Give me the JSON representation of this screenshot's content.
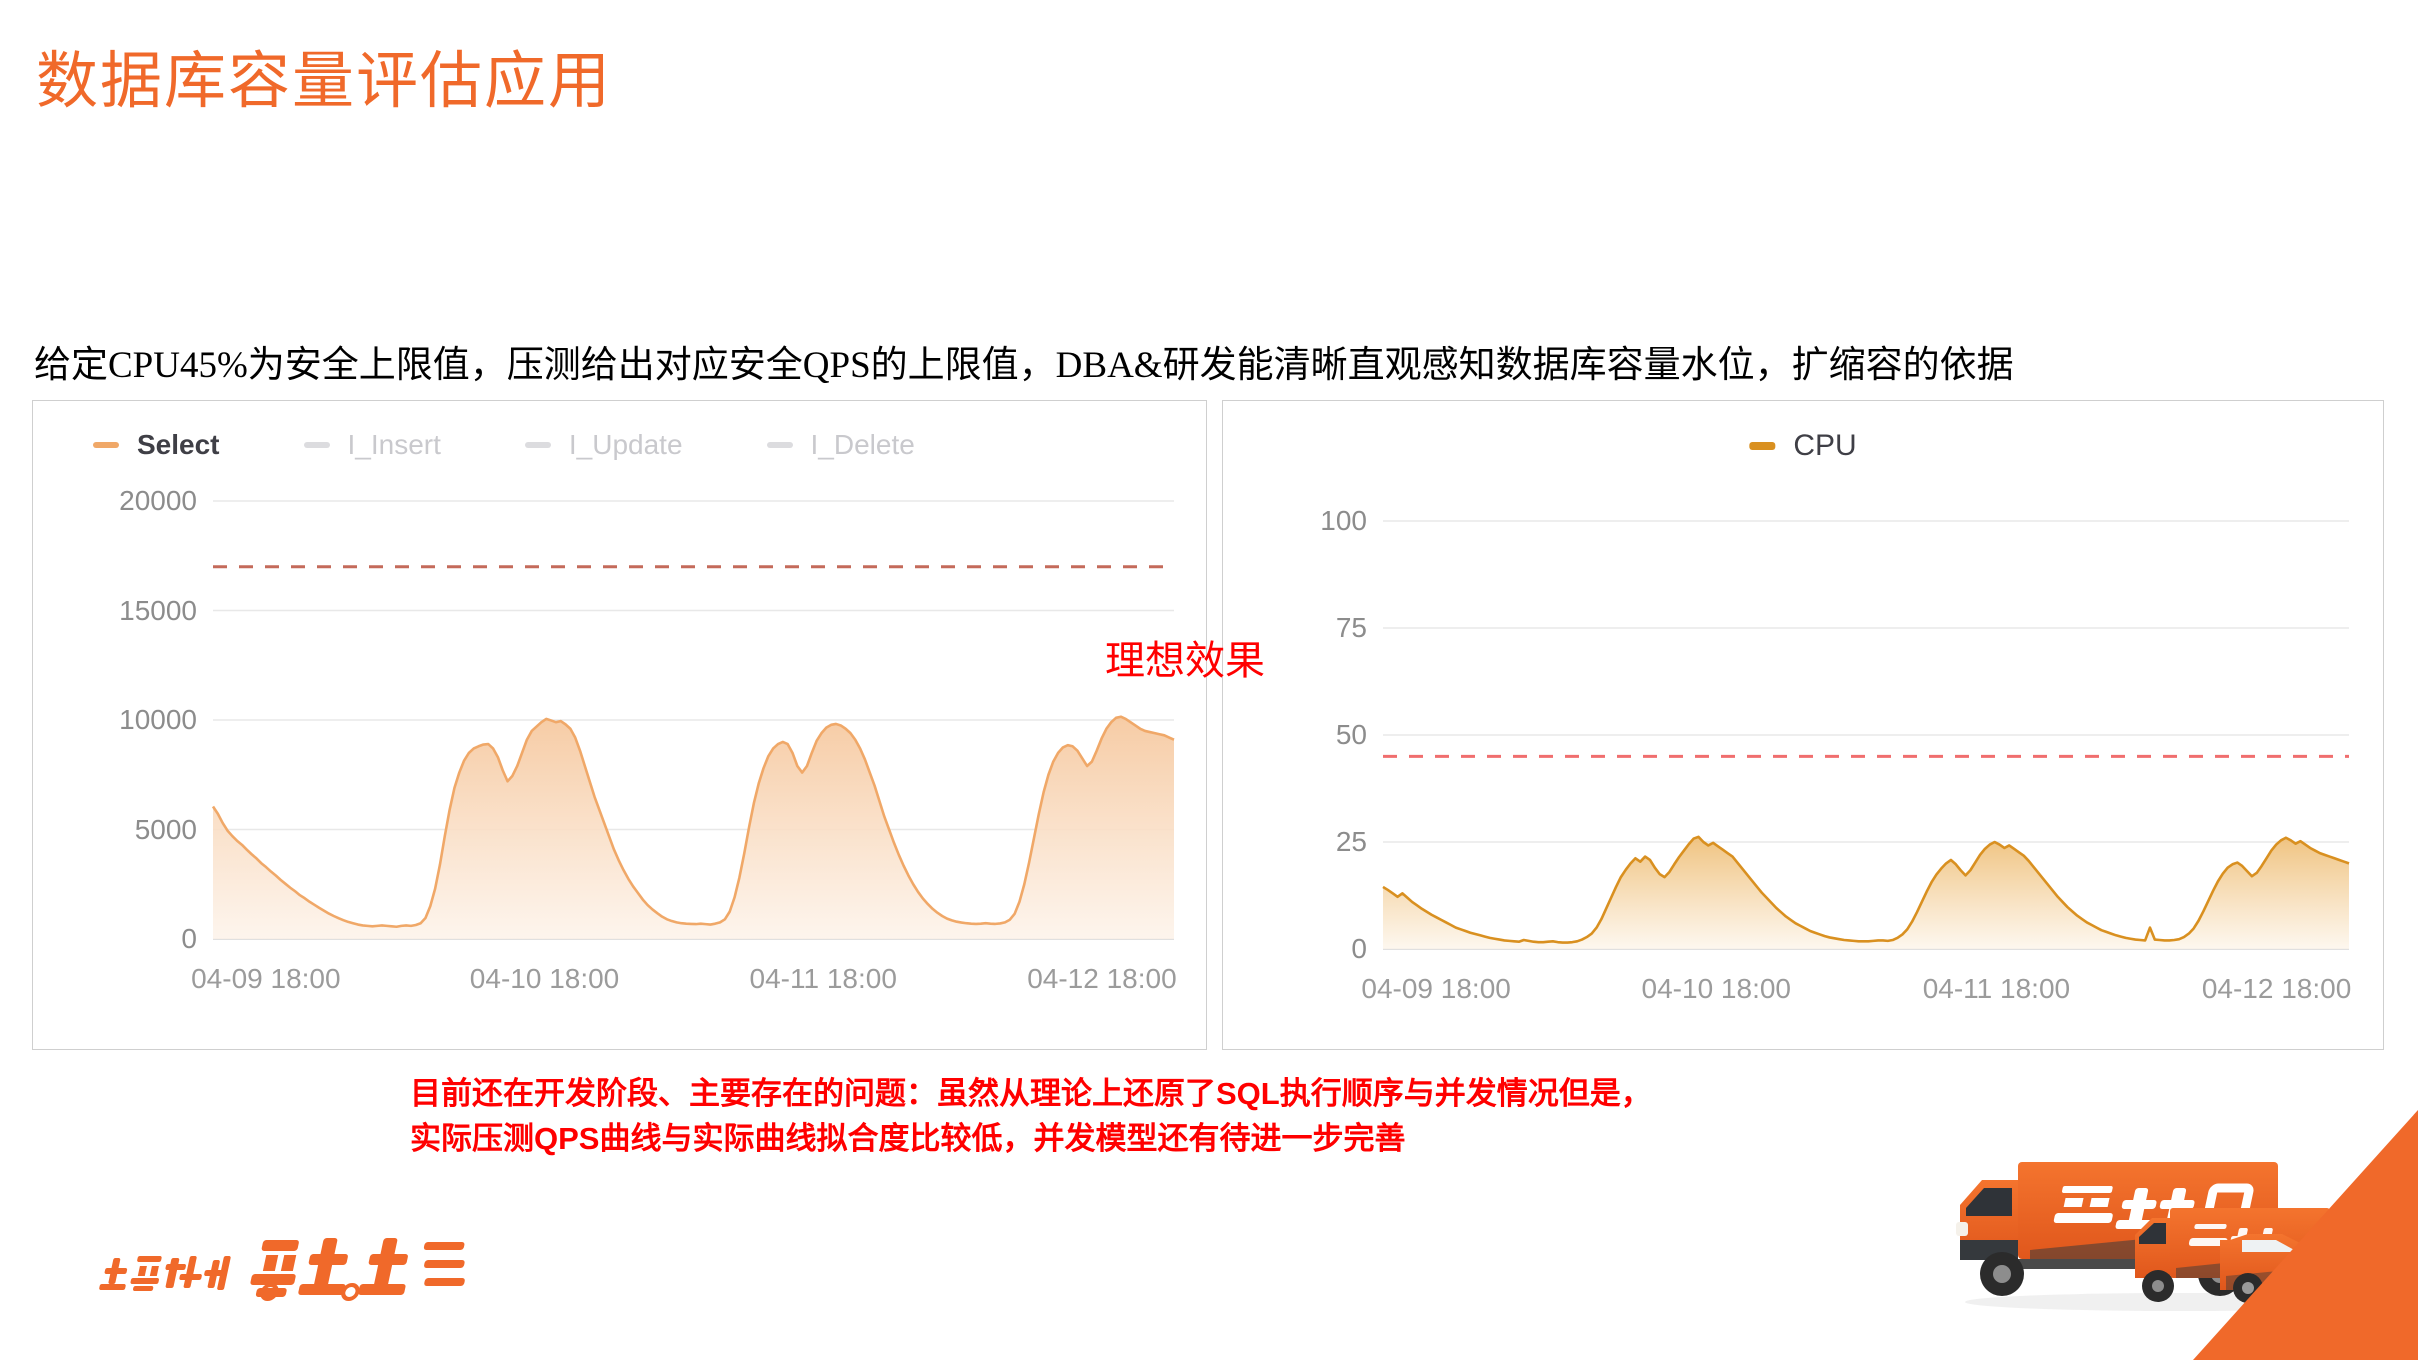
{
  "title": "数据库容量评估应用",
  "subtitle": "给定CPU45%为安全上限值，压测给出对应安全QPS的上限值，DBA&研发能清晰直观感知数据库容量水位，扩缩容的依据",
  "annotations": {
    "ideal_effect": "理想效果",
    "note_line1": "目前还在开发阶段、主要存在的问题：虽然从理论上还原了SQL执行顺序与并发情况但是，",
    "note_line2": "实际压测QPS曲线与实际曲线拟合度比较低，并发模型还有待进一步完善"
  },
  "brand": {
    "logo_text": "拉货就找货拉拉",
    "accent_orange": "#F0692A",
    "wedge_color": "#F0692A"
  },
  "chart_data": [
    {
      "type": "area",
      "title": "",
      "panel": "left",
      "legend": [
        {
          "label": "Select",
          "color": "#F0A868",
          "active": true
        },
        {
          "label": "I_Insert",
          "color": "#dcdcdf",
          "active": false
        },
        {
          "label": "I_Update",
          "color": "#dcdcdf",
          "active": false
        },
        {
          "label": "I_Delete",
          "color": "#dcdcdf",
          "active": false
        }
      ],
      "legend_position": "top-left",
      "xlabel": "",
      "ylabel": "",
      "ylim": [
        0,
        20000
      ],
      "yticks": [
        0,
        5000,
        10000,
        15000,
        20000
      ],
      "ytick_labels": [
        "0",
        "5000",
        "10000",
        "15000",
        "20000"
      ],
      "xtick_labels": [
        "04-09 18:00",
        "04-10 18:00",
        "04-11 18:00",
        "04-12 18:00"
      ],
      "xtick_positions": [
        0.055,
        0.345,
        0.635,
        0.925
      ],
      "grid": true,
      "threshold": {
        "value": 17000,
        "color": "#c46a5a",
        "style": "dashed",
        "label": ""
      },
      "series": [
        {
          "name": "Select",
          "color": "#F0A868",
          "fill_gradient": [
            "#F6C9A0",
            "#FDF3EA"
          ],
          "values": [
            6050,
            5720,
            5300,
            4950,
            4700,
            4480,
            4300,
            4080,
            3870,
            3680,
            3460,
            3280,
            3080,
            2900,
            2700,
            2520,
            2340,
            2180,
            2000,
            1860,
            1700,
            1560,
            1420,
            1290,
            1160,
            1050,
            950,
            860,
            780,
            720,
            660,
            620,
            600,
            580,
            600,
            620,
            600,
            580,
            560,
            600,
            620,
            600,
            640,
            720,
            960,
            1500,
            2300,
            3400,
            4700,
            5900,
            6900,
            7600,
            8150,
            8500,
            8700,
            8800,
            8880,
            8900,
            8700,
            8300,
            7700,
            7200,
            7450,
            7900,
            8500,
            9100,
            9500,
            9700,
            9900,
            10050,
            9980,
            9900,
            9950,
            9800,
            9600,
            9200,
            8600,
            7900,
            7200,
            6500,
            5900,
            5300,
            4700,
            4100,
            3600,
            3150,
            2750,
            2400,
            2100,
            1800,
            1550,
            1350,
            1180,
            1020,
            900,
            820,
            760,
            720,
            700,
            690,
            680,
            700,
            680,
            660,
            700,
            760,
            900,
            1250,
            1900,
            2800,
            3900,
            5100,
            6200,
            7100,
            7800,
            8350,
            8700,
            8900,
            9000,
            8900,
            8500,
            7900,
            7600,
            7900,
            8500,
            9050,
            9400,
            9650,
            9780,
            9820,
            9750,
            9600,
            9400,
            9100,
            8700,
            8200,
            7600,
            7000,
            6300,
            5600,
            5000,
            4400,
            3850,
            3350,
            2900,
            2500,
            2150,
            1850,
            1600,
            1380,
            1200,
            1050,
            930,
            850,
            790,
            750,
            720,
            700,
            690,
            700,
            720,
            700,
            690,
            710,
            760,
            880,
            1150,
            1700,
            2500,
            3500,
            4600,
            5700,
            6700,
            7500,
            8100,
            8500,
            8750,
            8850,
            8800,
            8600,
            8250,
            7900,
            8100,
            8600,
            9150,
            9600,
            9900,
            10100,
            10150,
            10050,
            9900,
            9750,
            9600,
            9500,
            9450,
            9400,
            9350,
            9300,
            9200,
            9100
          ]
        }
      ]
    },
    {
      "type": "area",
      "title": "",
      "panel": "right",
      "legend": [
        {
          "label": "CPU",
          "color": "#D99020",
          "active": true
        }
      ],
      "legend_position": "top-center",
      "xlabel": "",
      "ylabel": "",
      "ylim": [
        0,
        100
      ],
      "yticks": [
        0,
        25,
        50,
        75,
        100
      ],
      "ytick_labels": [
        "0",
        "25",
        "50",
        "75",
        "100"
      ],
      "xtick_labels": [
        "04-09 18:00",
        "04-10 18:00",
        "04-11 18:00",
        "04-12 18:00"
      ],
      "xtick_positions": [
        0.055,
        0.345,
        0.635,
        0.925
      ],
      "grid": true,
      "threshold": {
        "value": 45,
        "color": "#F06E6E",
        "style": "dashed",
        "label": ""
      },
      "series": [
        {
          "name": "CPU",
          "color": "#D99020",
          "fill_gradient": [
            "#EFC07A",
            "#FDF6EC"
          ],
          "values": [
            14.5,
            13.8,
            13.0,
            12.2,
            13.0,
            12.0,
            11.0,
            10.2,
            9.4,
            8.7,
            8.0,
            7.4,
            6.8,
            6.2,
            5.6,
            5.0,
            4.6,
            4.2,
            3.8,
            3.5,
            3.2,
            2.9,
            2.6,
            2.4,
            2.2,
            2.0,
            1.9,
            1.8,
            1.7,
            2.1,
            1.9,
            1.7,
            1.6,
            1.6,
            1.7,
            1.8,
            1.6,
            1.5,
            1.5,
            1.6,
            1.8,
            2.2,
            2.8,
            3.6,
            5.0,
            7.0,
            9.5,
            12.0,
            14.5,
            16.8,
            18.5,
            20.0,
            21.2,
            20.4,
            21.6,
            20.8,
            19.0,
            17.5,
            16.8,
            18.0,
            19.8,
            21.5,
            23.0,
            24.5,
            25.8,
            26.2,
            25.0,
            24.2,
            24.8,
            24.0,
            23.2,
            22.4,
            21.6,
            20.2,
            18.8,
            17.4,
            16.0,
            14.6,
            13.2,
            12.0,
            10.8,
            9.6,
            8.6,
            7.6,
            6.8,
            6.0,
            5.4,
            4.8,
            4.2,
            3.8,
            3.4,
            3.0,
            2.7,
            2.5,
            2.3,
            2.1,
            2.0,
            1.9,
            1.8,
            1.8,
            1.8,
            1.9,
            2.0,
            2.0,
            1.9,
            2.1,
            2.6,
            3.4,
            4.6,
            6.4,
            8.6,
            11.0,
            13.4,
            15.6,
            17.4,
            18.8,
            20.0,
            20.8,
            19.8,
            18.4,
            17.2,
            18.4,
            20.2,
            22.0,
            23.4,
            24.4,
            25.0,
            24.4,
            23.6,
            24.2,
            23.4,
            22.6,
            21.8,
            20.6,
            19.2,
            17.8,
            16.4,
            15.0,
            13.6,
            12.2,
            11.0,
            9.8,
            8.8,
            7.8,
            7.0,
            6.2,
            5.6,
            5.0,
            4.4,
            4.0,
            3.6,
            3.2,
            2.9,
            2.6,
            2.4,
            2.2,
            2.1,
            2.0,
            5.0,
            2.2,
            2.1,
            2.0,
            2.0,
            2.1,
            2.3,
            2.8,
            3.6,
            4.8,
            6.6,
            8.8,
            11.2,
            13.6,
            15.8,
            17.6,
            19.0,
            19.8,
            20.2,
            19.4,
            18.2,
            17.0,
            17.8,
            19.4,
            21.2,
            23.0,
            24.4,
            25.4,
            26.0,
            25.4,
            24.6,
            25.2,
            24.4,
            23.6,
            23.0,
            22.4,
            22.0,
            21.6,
            21.2,
            20.8,
            20.4,
            20.0
          ]
        }
      ]
    }
  ]
}
